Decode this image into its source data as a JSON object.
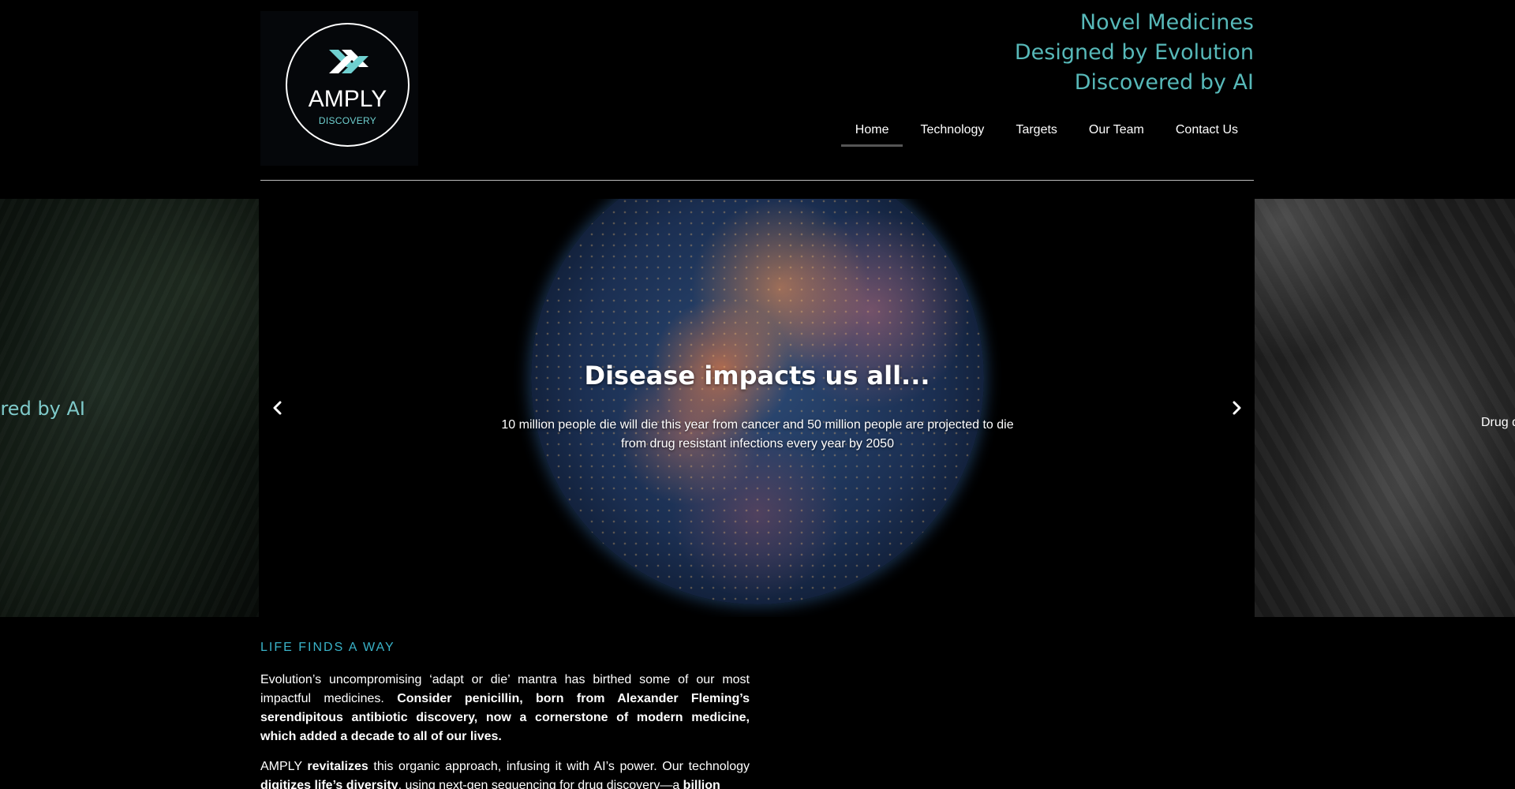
{
  "brand": {
    "name": "AMPLY",
    "subname": "DISCOVERY",
    "mark_colors": [
      "#ffffff",
      "#6fd0d0"
    ]
  },
  "tagline": {
    "line1": "Novel Medicines",
    "line2": "Designed by Evolution",
    "line3": "Discovered by AI",
    "color": "#57b9b9"
  },
  "nav": {
    "items": [
      {
        "label": "Home",
        "active": true
      },
      {
        "label": "Technology",
        "active": false
      },
      {
        "label": "Targets",
        "active": false
      },
      {
        "label": "Our Team",
        "active": false
      },
      {
        "label": "Contact Us",
        "active": false
      }
    ]
  },
  "slider": {
    "prev_slide_text": "ered by AI",
    "next_slide_text": "Drug d",
    "current": {
      "title": "Disease impacts us all...",
      "text": "10 million people die will die this year from cancer and 50 million people are projected to die from drug resistant infections every year by 2050"
    },
    "prev_icon": "chevron-left-icon",
    "next_icon": "chevron-right-icon"
  },
  "section": {
    "heading": "LIFE FINDS A WAY",
    "heading_color": "#3ab3c9",
    "p1": {
      "normal": "Evolution’s uncompromising ‘adapt or die’ mantra has birthed some of our most impactful medicines. ",
      "bold": "Consider penicillin, born from Alexander Fleming’s serendipitous antibiotic discovery, now a cornerstone of modern medicine, which added a decade to all of our lives."
    },
    "p2": {
      "t1": "AMPLY ",
      "b1": "revitalizes",
      "t2": " this organic approach, infusing it with AI’s power. Our technology ",
      "u1": "digitizes life’s diversity",
      "t3": ", using next-gen sequencing for drug discovery—a ",
      "b2": "billion"
    }
  }
}
